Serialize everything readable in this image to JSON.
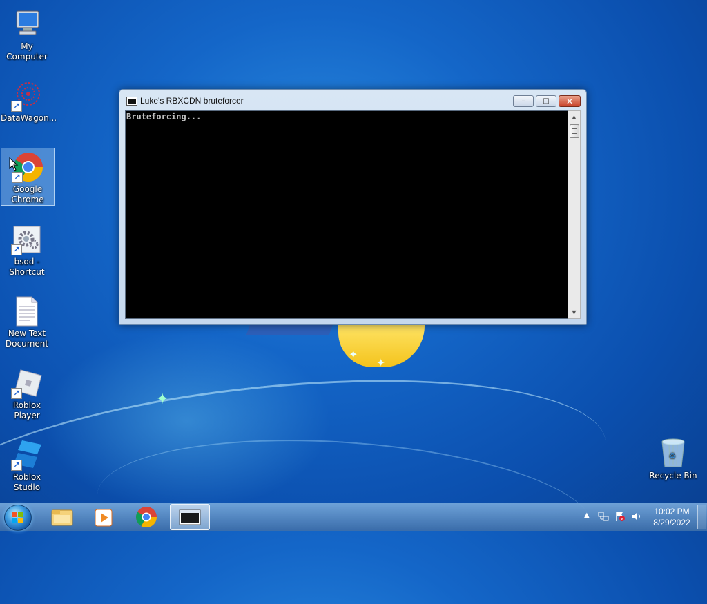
{
  "desktop": {
    "icons": [
      {
        "label": "My Computer"
      },
      {
        "label": "DataWagon..."
      },
      {
        "label": "Google Chrome"
      },
      {
        "label": "bsod - Shortcut"
      },
      {
        "label": "New Text Document"
      },
      {
        "label": "Roblox Player"
      },
      {
        "label": "Roblox Studio"
      },
      {
        "label": "Recycle Bin"
      }
    ]
  },
  "window": {
    "title": "Luke's RBXCDN bruteforcer",
    "minimize_label": "–",
    "maximize_label": "□",
    "close_label": "✕",
    "console_text": "Bruteforcing..."
  },
  "taskbar": {
    "pinned": [
      {
        "name": "file-explorer-icon"
      },
      {
        "name": "media-player-icon"
      },
      {
        "name": "chrome-icon"
      },
      {
        "name": "console-window-icon"
      }
    ],
    "tray_arrow": "▲",
    "clock_time": "10:02 PM",
    "clock_date": "8/29/2022"
  },
  "colors": {
    "desktop_blue": "#1466c8",
    "console_bg": "#000000",
    "console_fg": "#c0c0c0",
    "close_red": "#c8432a"
  }
}
